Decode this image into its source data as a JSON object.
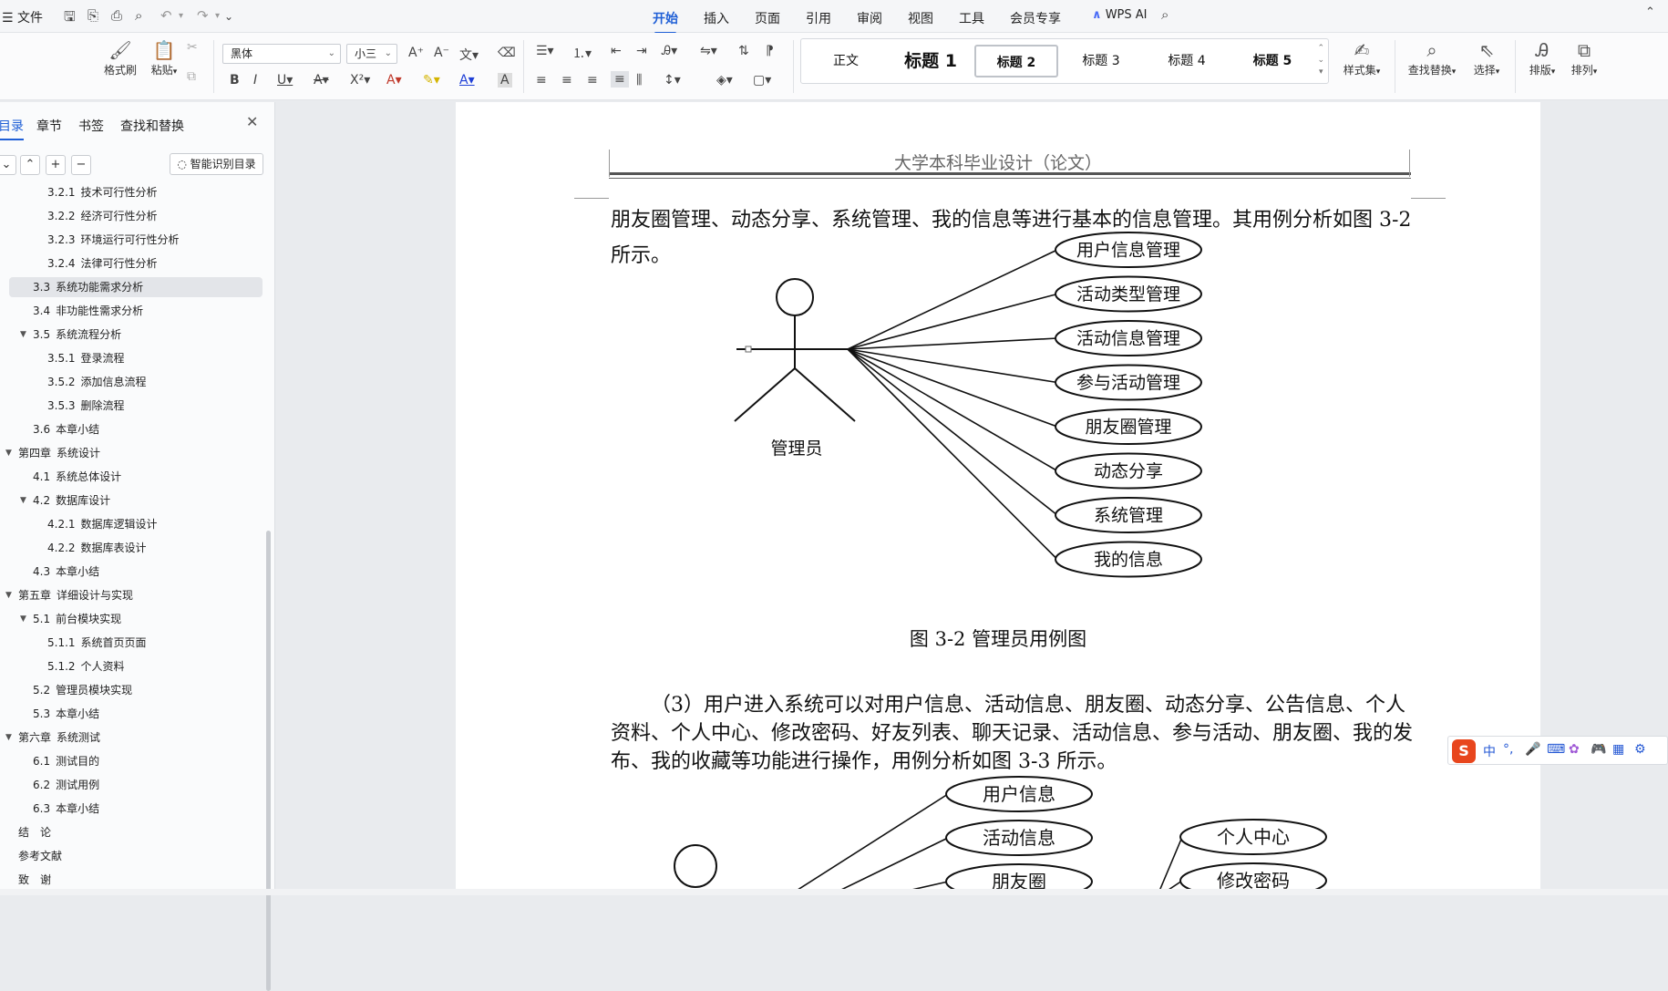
{
  "menubar": {
    "file_label": "文件",
    "tabs": [
      "开始",
      "插入",
      "页面",
      "引用",
      "审阅",
      "视图",
      "工具",
      "会员专享"
    ],
    "active_tab": "开始",
    "wps_ai_label": "WPS AI"
  },
  "ribbon": {
    "format_painter": "格式刷",
    "paste": "粘贴",
    "font_name": "黑体",
    "font_size": "小三",
    "styles": [
      "正文",
      "标题 1",
      "标题 2",
      "标题 3",
      "标题 4",
      "标题 5"
    ],
    "styles_set": "样式集",
    "find_replace": "查找替换",
    "select": "选择",
    "layout": "排版",
    "arrange": "排列"
  },
  "nav": {
    "tabs": [
      "目录",
      "章节",
      "书签",
      "查找和替换"
    ],
    "active_tab": "目录",
    "smart_toc_button": "智能识别目录",
    "toc": [
      {
        "num": "3.2.1",
        "text": "技术可行性分析",
        "level": 3
      },
      {
        "num": "3.2.2",
        "text": "经济可行性分析",
        "level": 3
      },
      {
        "num": "3.2.3",
        "text": "环境运行可行性分析",
        "level": 3
      },
      {
        "num": "3.2.4",
        "text": "法律可行性分析",
        "level": 3
      },
      {
        "num": "3.3",
        "text": "系统功能需求分析",
        "level": 2,
        "selected": true
      },
      {
        "num": "3.4",
        "text": "非功能性需求分析",
        "level": 2
      },
      {
        "num": "3.5",
        "text": "系统流程分析",
        "level": 2,
        "expanded": true
      },
      {
        "num": "3.5.1",
        "text": "登录流程",
        "level": 3
      },
      {
        "num": "3.5.2",
        "text": "添加信息流程",
        "level": 3
      },
      {
        "num": "3.5.3",
        "text": "删除流程",
        "level": 3
      },
      {
        "num": "3.6",
        "text": "本章小结",
        "level": 2
      },
      {
        "num": "第四章",
        "text": "系统设计",
        "level": 1,
        "expanded": true
      },
      {
        "num": "4.1",
        "text": "系统总体设计",
        "level": 2
      },
      {
        "num": "4.2",
        "text": "数据库设计",
        "level": 2,
        "expanded": true
      },
      {
        "num": "4.2.1",
        "text": "数据库逻辑设计",
        "level": 3
      },
      {
        "num": "4.2.2",
        "text": "数据库表设计",
        "level": 3
      },
      {
        "num": "4.3",
        "text": "本章小结",
        "level": 2
      },
      {
        "num": "第五章",
        "text": "详细设计与实现",
        "level": 1,
        "expanded": true
      },
      {
        "num": "5.1",
        "text": "前台模块实现",
        "level": 2,
        "expanded": true
      },
      {
        "num": "5.1.1",
        "text": "系统首页页面",
        "level": 3
      },
      {
        "num": "5.1.2",
        "text": "个人资料",
        "level": 3
      },
      {
        "num": "5.2",
        "text": "管理员模块实现",
        "level": 2
      },
      {
        "num": "5.3",
        "text": "本章小结",
        "level": 2
      },
      {
        "num": "第六章",
        "text": "系统测试",
        "level": 1,
        "expanded": true
      },
      {
        "num": "6.1",
        "text": "测试目的",
        "level": 2
      },
      {
        "num": "6.2",
        "text": "测试用例",
        "level": 2
      },
      {
        "num": "6.3",
        "text": "本章小结",
        "level": 2
      },
      {
        "num": "",
        "text": "结　论",
        "level": 1
      },
      {
        "num": "",
        "text": "参考文献",
        "level": 1
      },
      {
        "num": "",
        "text": "致　谢",
        "level": 1
      }
    ]
  },
  "document": {
    "header": "大学本科毕业设计（论文）",
    "para1": "朋友圈管理、动态分享、系统管理、我的信息等进行基本的信息管理。其用例分析如图 3-2 所示。",
    "figure1": {
      "actor": "管理员",
      "use_cases": [
        "用户信息管理",
        "活动类型管理",
        "活动信息管理",
        "参与活动管理",
        "朋友圈管理",
        "动态分享",
        "系统管理",
        "我的信息"
      ],
      "caption": "图 3-2  管理员用例图"
    },
    "para2": "（3）用户进入系统可以对用户信息、活动信息、朋友圈、动态分享、公告信息、个人资料、个人中心、修改密码、好友列表、聊天记录、活动信息、参与活动、朋友圈、我的发布、我的收藏等功能进行操作，用例分析如图 3-3 所示。",
    "figure2": {
      "left_cases": [
        "用户信息",
        "活动信息",
        "朋友圈"
      ],
      "right_cases": [
        "个人中心",
        "修改密码"
      ]
    }
  },
  "ime": {
    "logo": "S",
    "mode": "中"
  }
}
